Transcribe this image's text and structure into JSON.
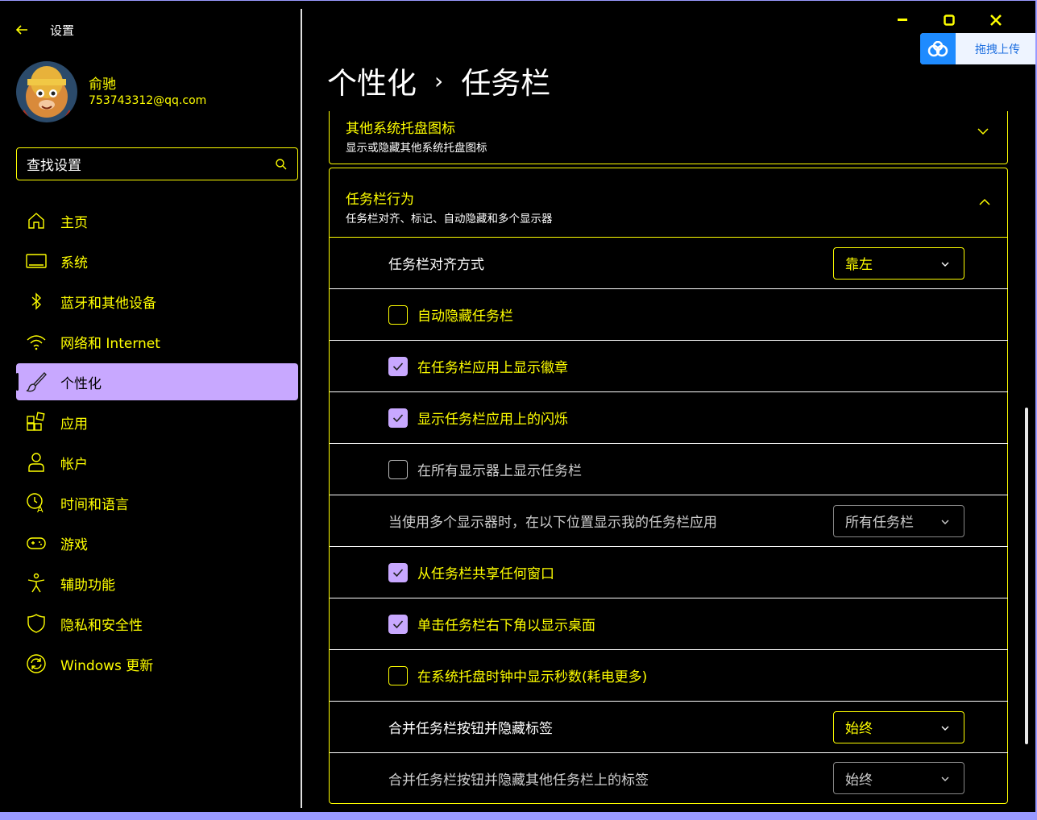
{
  "app": {
    "title": "设置"
  },
  "profile": {
    "name": "俞驰",
    "email": "753743312@qq.com"
  },
  "search": {
    "placeholder": "查找设置"
  },
  "nav": {
    "items": [
      {
        "label": "主页",
        "icon": "home-icon"
      },
      {
        "label": "系统",
        "icon": "monitor-icon"
      },
      {
        "label": "蓝牙和其他设备",
        "icon": "bluetooth-icon"
      },
      {
        "label": "网络和 Internet",
        "icon": "wifi-icon"
      },
      {
        "label": "个性化",
        "icon": "brush-icon",
        "active": true
      },
      {
        "label": "应用",
        "icon": "apps-icon"
      },
      {
        "label": "帐户",
        "icon": "person-icon"
      },
      {
        "label": "时间和语言",
        "icon": "globe-clock-icon"
      },
      {
        "label": "游戏",
        "icon": "gamepad-icon"
      },
      {
        "label": "辅助功能",
        "icon": "accessibility-icon"
      },
      {
        "label": "隐私和安全性",
        "icon": "shield-icon"
      },
      {
        "label": "Windows 更新",
        "icon": "refresh-icon"
      }
    ]
  },
  "baidu": {
    "label": "拖拽上传"
  },
  "breadcrumb": {
    "parent": "个性化",
    "separator": "›",
    "current": "任务栏"
  },
  "tray_card": {
    "title": "其他系统托盘图标",
    "subtitle": "显示或隐藏其他系统托盘图标"
  },
  "behavior_card": {
    "title": "任务栏行为",
    "subtitle": "任务栏对齐、标记、自动隐藏和多个显示器"
  },
  "settings": {
    "alignment_label": "任务栏对齐方式",
    "alignment_value": "靠左",
    "auto_hide": "自动隐藏任务栏",
    "show_badges": "在任务栏应用上显示徽章",
    "show_flashing": "显示任务栏应用上的闪烁",
    "all_displays": "在所有显示器上显示任务栏",
    "multi_display_label": "当使用多个显示器时，在以下位置显示我的任务栏应用",
    "multi_display_value": "所有任务栏",
    "share_window": "从任务栏共享任何窗口",
    "far_corner": "单击任务栏右下角以显示桌面",
    "show_seconds": "在系统托盘时钟中显示秒数(耗电更多)",
    "combine_label": "合并任务栏按钮并隐藏标签",
    "combine_value": "始终",
    "combine_other_label": "合并任务栏按钮并隐藏其他任务栏上的标签",
    "combine_other_value": "始终"
  },
  "checkbox_states": {
    "auto_hide": false,
    "show_badges": true,
    "show_flashing": true,
    "all_displays": false,
    "share_window": true,
    "far_corner": true,
    "show_seconds": false
  },
  "colors": {
    "accent": "#ffff00",
    "selection": "#c8a8ff",
    "window_border": "#9a9aff",
    "background": "#000000"
  }
}
